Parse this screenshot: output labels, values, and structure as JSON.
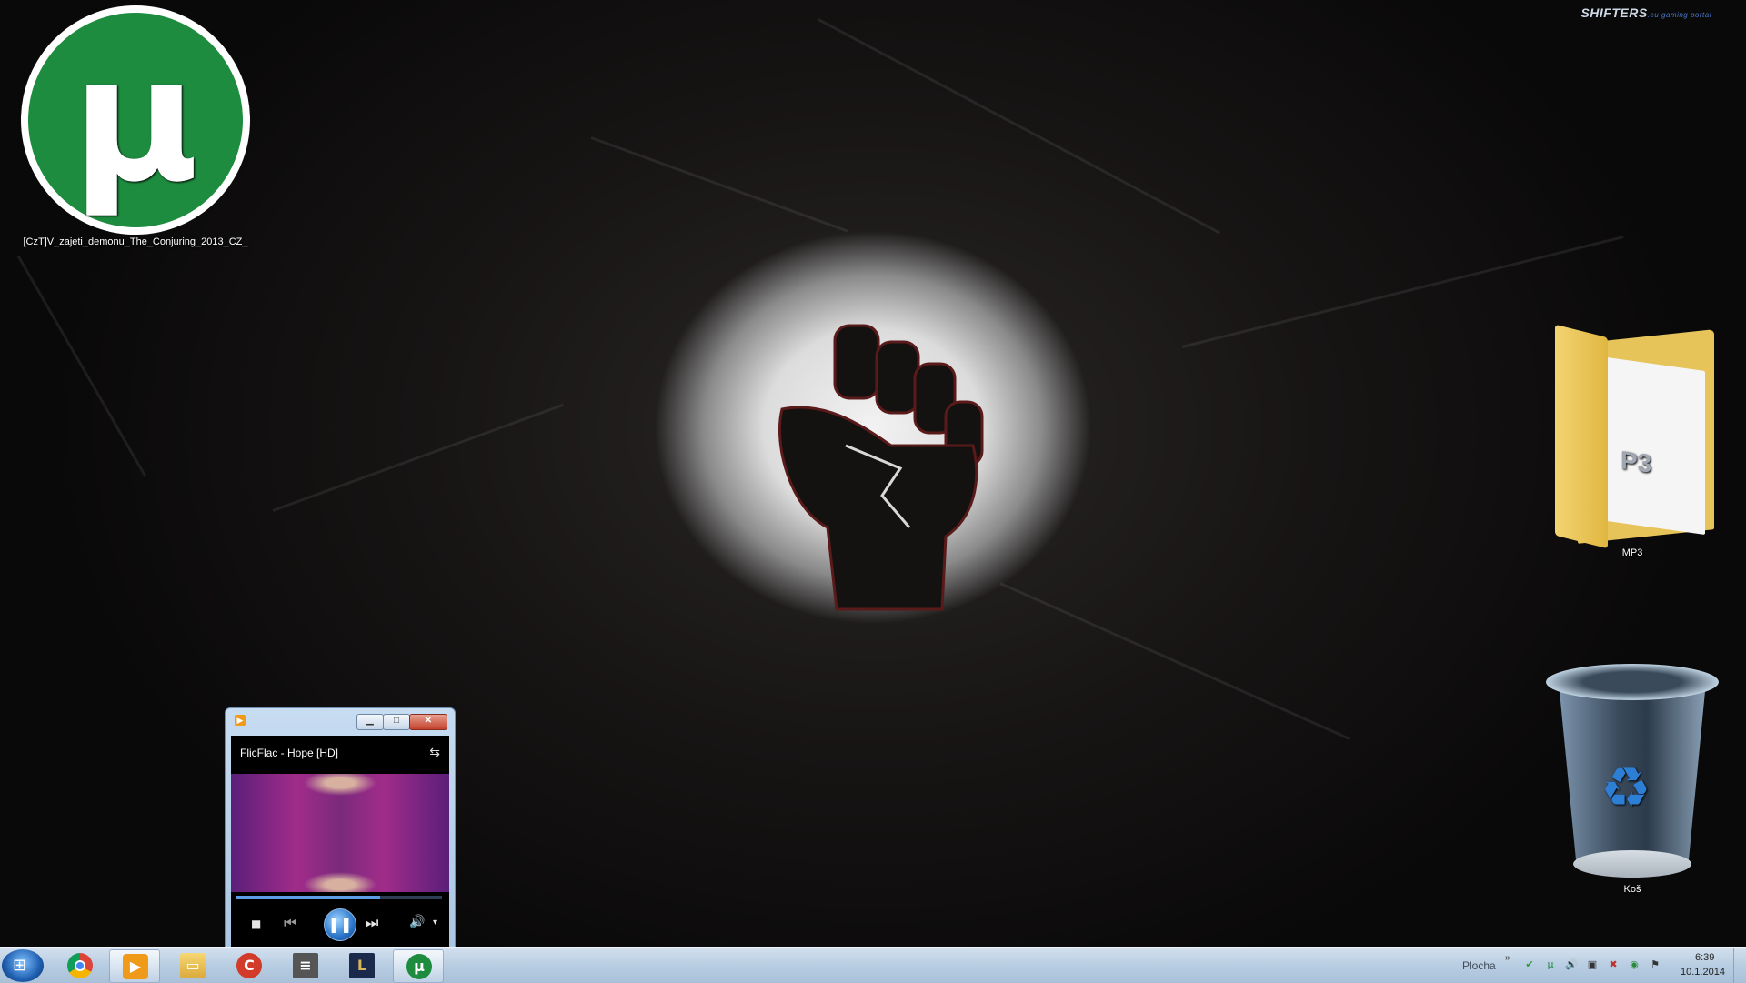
{
  "brand": {
    "name": "SHIFTERS",
    "suffix": ".eu gaming portal"
  },
  "desktop_icons": {
    "utorrent": {
      "label": "[CzT]V_zajeti_demonu_The_Conjuring_2013_CZ_",
      "glyph": "µ",
      "color": "#1d8c3f"
    },
    "mp3_folder": {
      "label": "MP3",
      "badge": "P3"
    },
    "recycle_bin": {
      "label": "Koš",
      "glyph": "♻"
    }
  },
  "player": {
    "app_glyph": "▶",
    "minimize": "▁",
    "maximize": "□",
    "close": "✕",
    "track_title": "FlicFlac - Hope [HD]",
    "switch_glyph": "⇆",
    "seek_progress": 0.7,
    "stop_glyph": "■",
    "prev_glyph": "⏮",
    "pause_glyph": "❚❚",
    "next_glyph": "⏭",
    "volume_glyph": "🔊",
    "dropdown_glyph": "▾"
  },
  "taskbar": {
    "start_glyph": "⊞",
    "apps": [
      {
        "id": "chrome",
        "glyph": ""
      },
      {
        "id": "wmp",
        "glyph": "▶"
      },
      {
        "id": "explorer",
        "glyph": "▭"
      },
      {
        "id": "ccleaner",
        "glyph": "C"
      },
      {
        "id": "app5",
        "glyph": "≡"
      },
      {
        "id": "lol",
        "glyph": "L"
      },
      {
        "id": "utorrent",
        "glyph": "µ"
      }
    ],
    "desktop_toolbar_label": "Plocha",
    "tray_chevron": "»",
    "tray_icons": [
      {
        "name": "network-green-icon",
        "glyph": "✔",
        "color": "#2a9a3a"
      },
      {
        "name": "utorrent-tray-icon",
        "glyph": "µ",
        "color": "#1d8c3f"
      },
      {
        "name": "volume-tray-icon",
        "glyph": "🔊",
        "color": "#333"
      },
      {
        "name": "display-tray-icon",
        "glyph": "▣",
        "color": "#333"
      },
      {
        "name": "alert-tray-icon",
        "glyph": "✖",
        "color": "#c03030"
      },
      {
        "name": "shield-tray-icon",
        "glyph": "◉",
        "color": "#2a8a3a"
      },
      {
        "name": "flag-tray-icon",
        "glyph": "⚑",
        "color": "#333"
      }
    ],
    "clock_time": "6:39",
    "clock_date": "10.1.2014"
  }
}
